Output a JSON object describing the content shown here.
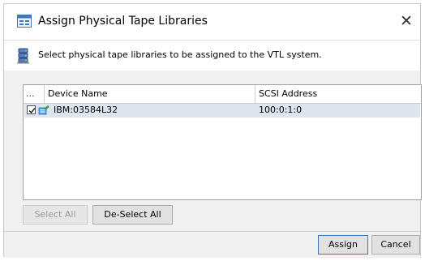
{
  "dialog": {
    "title": "Assign Physical Tape Libraries",
    "close_symbol": "✕",
    "header_text": "Select physical tape libraries to be assigned to the VTL system."
  },
  "table": {
    "columns": [
      "...",
      "Device Name",
      "SCSI Address"
    ],
    "rows": [
      {
        "selected": true,
        "device_name": "IBM:03584L32",
        "scsi_address": "100:0:1:0"
      }
    ]
  },
  "buttons": {
    "select_all": "Select All",
    "deselect_all": "De-Select All",
    "assign": "Assign",
    "cancel": "Cancel"
  },
  "icons": {
    "title": "dialog-app-icon",
    "header": "server-stack-icon",
    "row": "tape-library-icon"
  },
  "colors": {
    "selected_row": "#dde5ef",
    "content_bg": "#f0f0f0"
  }
}
